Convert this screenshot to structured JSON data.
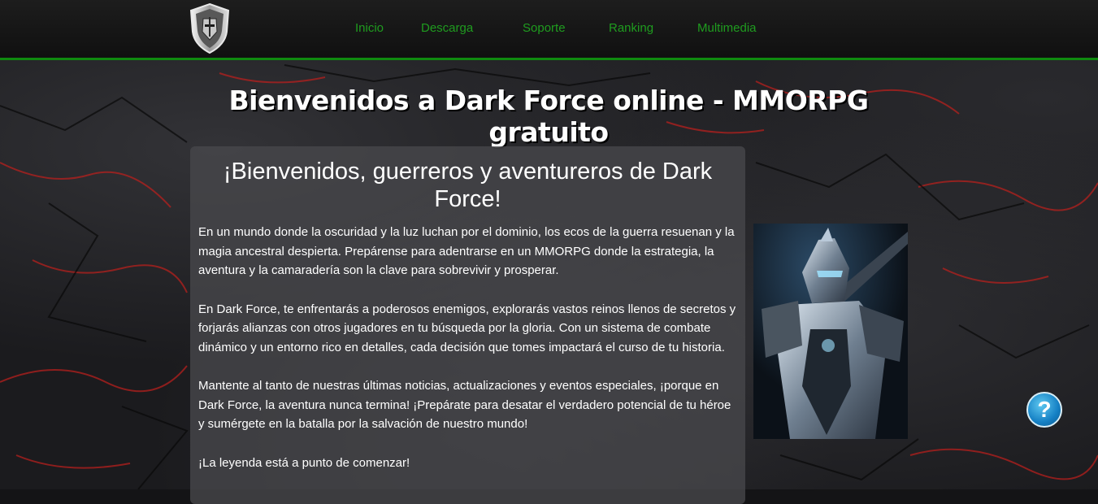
{
  "nav": {
    "items": [
      {
        "label": "Inicio",
        "color": "#1f9c1f"
      },
      {
        "label": "Descarga",
        "color": "#1f9c1f"
      },
      {
        "label": "Soporte",
        "color": "#1f9c1f"
      },
      {
        "label": "Ranking",
        "color": "#1f9c1f"
      },
      {
        "label": "Multimedia",
        "color": "#1f9c1f"
      }
    ],
    "logo_icon": "knight-shield-logo",
    "accent_color": "#0f8a0f"
  },
  "main": {
    "title": "Bienvenidos a Dark Force online - MMORPG gratuito",
    "box_heading": "¡Bienvenidos, guerreros y aventureros de Dark Force!",
    "paragraphs": [
      "En un mundo donde la oscuridad y la luz luchan por el dominio, los ecos de la guerra resuenan y la magia ancestral despierta. Prepárense para adentrarse en un MMORPG donde la estrategia, la aventura y la camaradería son la clave para sobrevivir y prosperar.",
      "En Dark Force, te enfrentarás a poderosos enemigos, explorarás vastos reinos llenos de secretos y forjarás alianzas con otros jugadores en tu búsqueda por la gloria. Con un sistema de combate dinámico y un entorno rico en detalles, cada decisión que tomes impactará el curso de tu historia.",
      "Mantente al tanto de nuestras últimas noticias, actualizaciones y eventos especiales, ¡porque en Dark Force, la aventura nunca termina! ¡Prepárate para desatar el verdadero potencial de tu héroe y sumérgete en la batalla por la salvación de nuestro mundo!",
      "¡La leyenda está a punto de comenzar!"
    ],
    "hero_image": "armored-knight-image"
  },
  "help": {
    "label": "?",
    "icon": "help-question-icon",
    "color": "#1580c4"
  },
  "background": {
    "base": "#1b1b1e",
    "crack_color": "#c0201c"
  }
}
